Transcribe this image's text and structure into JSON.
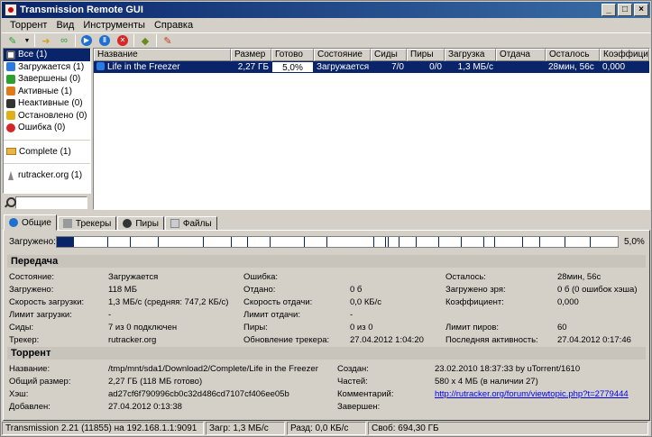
{
  "window": {
    "title": "Transmission Remote GUI",
    "minimize": "_",
    "maximize": "□",
    "close": "×"
  },
  "menu": [
    "Торрент",
    "Вид",
    "Инструменты",
    "Справка"
  ],
  "sidebar": {
    "items": [
      {
        "label": "Все (1)",
        "color": "#3a3a3a"
      },
      {
        "label": "Загружается (1)",
        "color": "#2a7ae2"
      },
      {
        "label": "Завершены (0)",
        "color": "#2ca02c"
      },
      {
        "label": "Активные (1)",
        "color": "#e07b1a"
      },
      {
        "label": "Неактивные (0)",
        "color": "#333333"
      },
      {
        "label": "Остановлено (0)",
        "color": "#e0b01a"
      },
      {
        "label": "Ошибка (0)",
        "color": "#d62728"
      }
    ],
    "folder": "Complete (1)",
    "tracker": "rutracker.org (1)",
    "search_value": ""
  },
  "list": {
    "columns": [
      "Название",
      "Размер",
      "Готово",
      "Состояние",
      "Сиды",
      "Пиры",
      "Загрузка",
      "Отдача",
      "Осталось",
      "Коэффицие"
    ],
    "row": [
      "Life in the Freezer",
      "2,27 ГБ",
      "5,0%",
      "Загружается",
      "7/0",
      "0/0",
      "1,3 МБ/с",
      "",
      "28мин, 56с",
      "0,000"
    ]
  },
  "tabs": [
    "Общие",
    "Трекеры",
    "Пиры",
    "Файлы"
  ],
  "pieces": {
    "label": "Загружено:",
    "percent": "5,0%",
    "done_fraction": 0.05
  },
  "transfer": {
    "title": "Передача",
    "state_l": "Состояние:",
    "state_v": "Загружается",
    "downloaded_l": "Загружено:",
    "downloaded_v": "118 МБ",
    "dlspeed_l": "Скорость загрузки:",
    "dlspeed_v": "1,3 МБ/с (средняя: 747,2 КБ/с)",
    "dllimit_l": "Лимит загрузки:",
    "dllimit_v": "-",
    "seeds_l": "Сиды:",
    "seeds_v": "7 из 0 подключен",
    "tracker_l": "Трекер:",
    "tracker_v": "rutracker.org",
    "error_l": "Ошибка:",
    "error_v": "",
    "uploaded_l": "Отдано:",
    "uploaded_v": "0 б",
    "ulspeed_l": "Скорость отдачи:",
    "ulspeed_v": "0,0 КБ/с",
    "ullimit_l": "Лимит отдачи:",
    "ullimit_v": "-",
    "peers_l": "Пиры:",
    "peers_v": "0 из 0",
    "trkupdate_l": "Обновление трекера:",
    "trkupdate_v": "27.04.2012 1:04:20",
    "remaining_l": "Осталось:",
    "remaining_v": "28мин, 56с",
    "wasted_l": "Загружено зря:",
    "wasted_v": "0 б (0 ошибок хэша)",
    "ratio_l": "Коэффициент:",
    "ratio_v": "0,000",
    "peerlimit_l": "Лимит пиров:",
    "peerlimit_v": "60",
    "lastactive_l": "Последняя активность:",
    "lastactive_v": "27.04.2012 0:17:46"
  },
  "torrent": {
    "title": "Торрент",
    "name_l": "Название:",
    "name_v": "/tmp/mnt/sda1/Download2/Complete/Life in the Freezer",
    "size_l": "Общий размер:",
    "size_v": "2,27 ГБ (118 МБ готово)",
    "hash_l": "Хэш:",
    "hash_v": "ad27cf6f790996cb0c32d486cd7107cf406ee05b",
    "added_l": "Добавлен:",
    "added_v": "27.04.2012 0:13:38",
    "created_l": "Создан:",
    "created_v": "23.02.2010 18:37:33 by uTorrent/1610",
    "pieces_l": "Частей:",
    "pieces_v": "580 x 4 МБ (в наличии 27)",
    "comment_l": "Комментарий:",
    "comment_v": "http://rutracker.org/forum/viewtopic.php?t=2779444",
    "completed_l": "Завершен:",
    "completed_v": ""
  },
  "status": {
    "version": "Transmission 2.21 (11855) на 192.168.1.1:9091",
    "down": "Загр: 1,3 МБ/с",
    "up": "Разд: 0,0 КБ/с",
    "free": "Своб: 694,30 ГБ"
  }
}
